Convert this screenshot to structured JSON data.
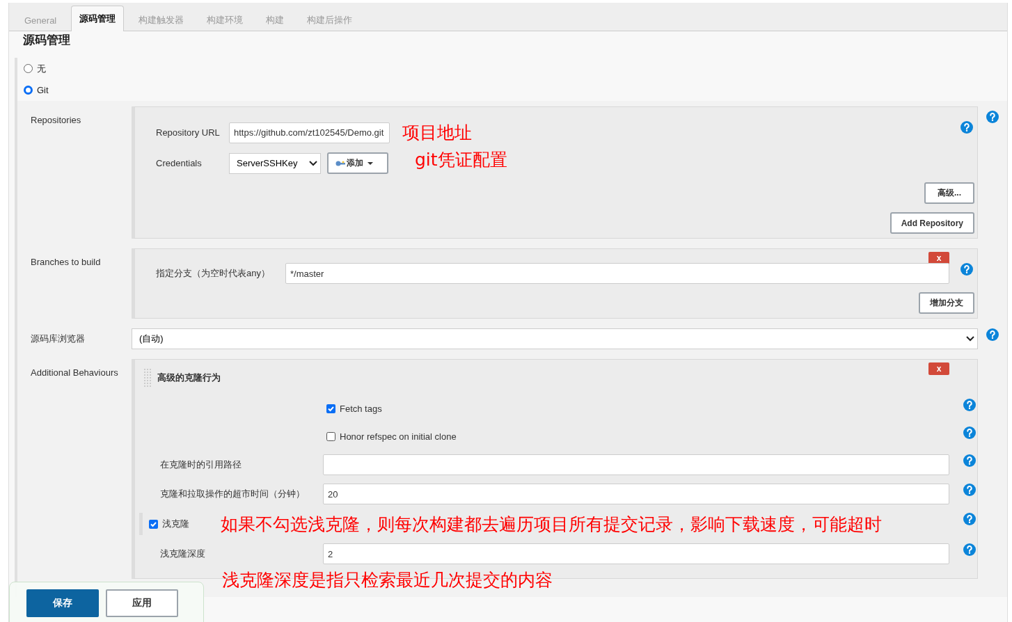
{
  "tabs": [
    {
      "label": "General",
      "selected": false
    },
    {
      "label": "源码管理",
      "selected": true
    },
    {
      "label": "构建触发器",
      "selected": false
    },
    {
      "label": "构建环境",
      "selected": false
    },
    {
      "label": "构建",
      "selected": false
    },
    {
      "label": "构建后操作",
      "selected": false
    }
  ],
  "section_title": "源码管理",
  "scm_options": [
    {
      "label": "无",
      "selected": false
    },
    {
      "label": "Git",
      "selected": true
    }
  ],
  "repositories": {
    "label": "Repositories",
    "url_label": "Repository URL",
    "url": "https://github.com/zt102545/Demo.git",
    "url_note": "项目地址",
    "credentials_label": "Credentials",
    "credentials": "ServerSSHKey",
    "add_button": "添加",
    "credentials_note": "git凭证配置",
    "advanced_button": "高级...",
    "add_repository_button": "Add Repository"
  },
  "branches": {
    "label": "Branches to build",
    "delete_button": "x",
    "spec_label": "指定分支（为空时代表any）",
    "spec": "*/master",
    "add_branch_button": "增加分支"
  },
  "browser": {
    "label": "源码库浏览器",
    "value": "(自动)"
  },
  "behaviours": {
    "label": "Additional Behaviours",
    "title": "高级的克隆行为",
    "delete_button": "x",
    "items": [
      {
        "kind": "checkbox",
        "label": "Fetch tags",
        "checked": true
      },
      {
        "kind": "checkbox",
        "label": "Honor refspec on initial clone",
        "checked": false
      },
      {
        "kind": "field",
        "label": "在克隆时的引用路径"
      },
      {
        "kind": "field",
        "label": "克隆和拉取操作的超市时间（分钟）",
        "value": "20"
      },
      {
        "kind": "toggle",
        "label": "浅克隆",
        "checked": true,
        "note": "如果不勾选浅克隆，则每次构建都去遍历项目所有提交记录，影响下载速度，可能超时"
      },
      {
        "kind": "field",
        "label": "浅克隆深度",
        "value": "2",
        "note": "浅克隆深度是指只检索最近几次提交的内容"
      }
    ]
  },
  "footer": {
    "save_button": "保存",
    "apply_button": "应用"
  }
}
